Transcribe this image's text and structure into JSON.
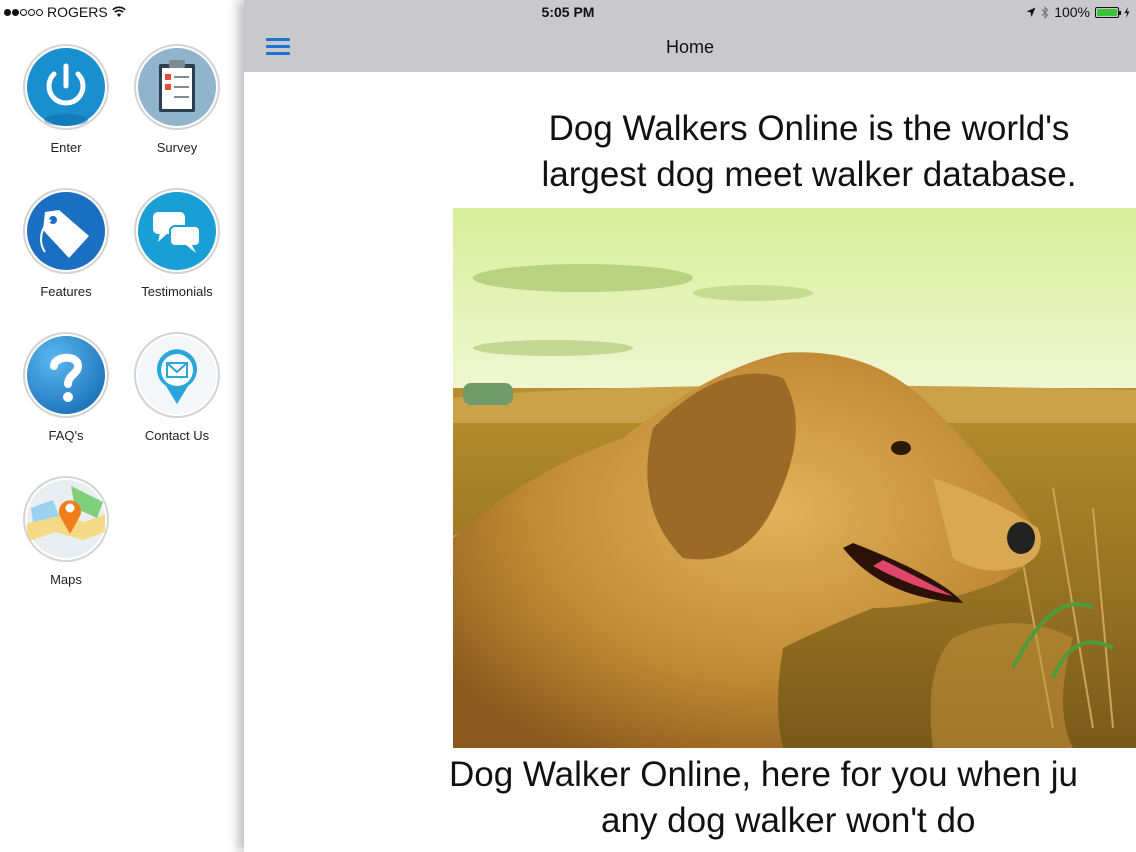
{
  "status_bar": {
    "carrier": "ROGERS",
    "time": "5:05 PM",
    "battery": "100%",
    "signal_bars": 2
  },
  "nav": {
    "title": "Home",
    "menu_icon": "hamburger-icon"
  },
  "menu": {
    "items": [
      {
        "label": "Enter",
        "icon": "power-icon"
      },
      {
        "label": "Survey",
        "icon": "clipboard-icon"
      },
      {
        "label": "Features",
        "icon": "tag-icon"
      },
      {
        "label": "Testimonials",
        "icon": "chat-bubbles-icon"
      },
      {
        "label": "FAQ's",
        "icon": "question-mark-icon"
      },
      {
        "label": "Contact Us",
        "icon": "envelope-pin-icon"
      },
      {
        "label": "Maps",
        "icon": "map-pin-icon"
      }
    ]
  },
  "content": {
    "headline": "Dog Walkers Online is the world's largest dog meet walker database.",
    "caption_line1": "Dog Walker Online, here for you when ju",
    "caption_line2": "any dog walker won't do"
  },
  "colors": {
    "accent": "#1c73d6",
    "nav_bar": "#c9c9cb",
    "icon_blue": "#1a8fd0",
    "map_pin": "#f07d1a",
    "battery": "#3ec13a"
  }
}
